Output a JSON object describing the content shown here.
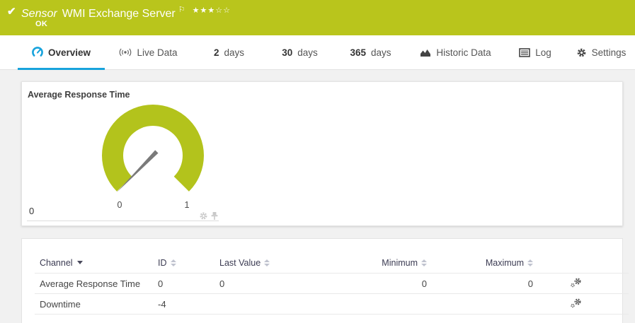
{
  "header": {
    "check": "✔",
    "kind_label": "Sensor",
    "title": "WMI Exchange Server",
    "flag": "⚐",
    "stars_filled": "★★★",
    "stars_empty": "☆☆",
    "status": "OK",
    "green": "#b9c51c"
  },
  "tabs": {
    "overview": {
      "label": "Overview"
    },
    "livedata": {
      "label": "Live Data"
    },
    "d2": {
      "num": "2",
      "label": "days"
    },
    "d30": {
      "num": "30",
      "label": "days"
    },
    "d365": {
      "num": "365",
      "label": "days"
    },
    "historic": {
      "label": "Historic Data"
    },
    "log": {
      "label": "Log"
    },
    "settings": {
      "label": "Settings"
    }
  },
  "gauge_panel": {
    "title": "Average Response Time",
    "scale_min": "0",
    "scale_max": "1",
    "baseline_value": "0",
    "gauge": {
      "min": 0,
      "max": 1,
      "value": 0,
      "arc_color": "#b3c31c",
      "needle_color": "#7a7a7a"
    }
  },
  "table": {
    "columns": {
      "channel": "Channel",
      "id": "ID",
      "last": "Last Value",
      "min": "Minimum",
      "max": "Maximum"
    },
    "rows": [
      {
        "channel": "Average Response Time",
        "id": "0",
        "last": "0",
        "min": "0",
        "max": "0"
      },
      {
        "channel": "Downtime",
        "id": "-4",
        "last": "",
        "min": "",
        "max": ""
      }
    ]
  }
}
